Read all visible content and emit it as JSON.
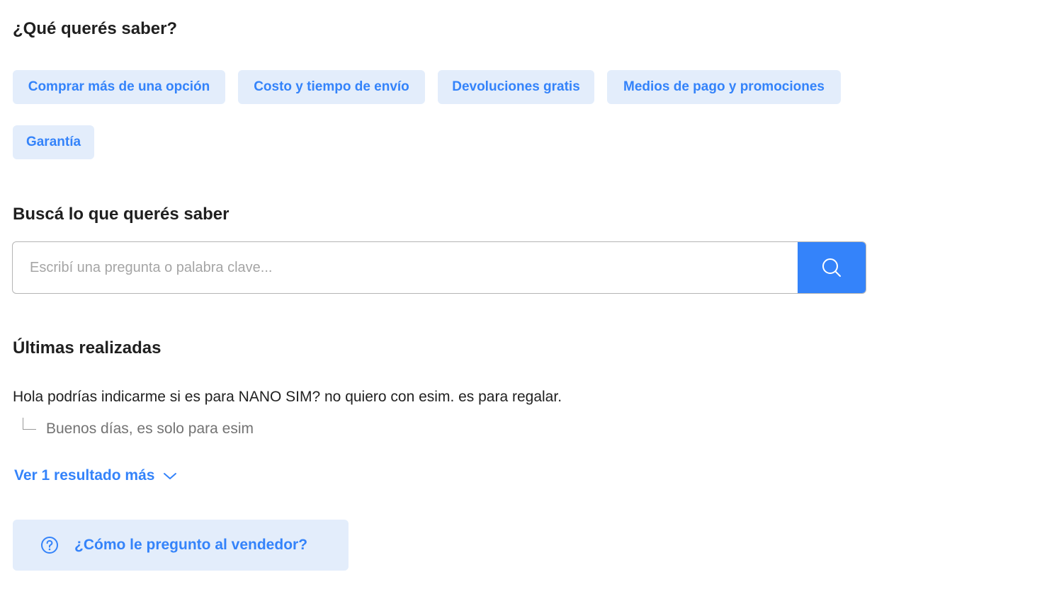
{
  "quick_questions": {
    "title": "¿Qué querés saber?",
    "chips": [
      "Comprar más de una opción",
      "Costo y tiempo de envío",
      "Devoluciones gratis",
      "Medios de pago y promociones",
      "Garantía"
    ]
  },
  "search": {
    "title": "Buscá lo que querés saber",
    "placeholder": "Escribí una pregunta o palabra clave...",
    "value": "",
    "button_icon": "search-icon"
  },
  "recent": {
    "title": "Últimas realizadas",
    "items": [
      {
        "question": "Hola podrías indicarme si es para NANO SIM? no quiero con esim. es para regalar.",
        "answer": "Buenos días, es solo para esim"
      }
    ],
    "more_label": "Ver 1 resultado más",
    "more_icon": "chevron-down-icon"
  },
  "help": {
    "label": "¿Cómo le pregunto al vendedor?",
    "icon": "question-circle-icon"
  },
  "colors": {
    "accent": "#3483fa",
    "chip_background": "#e3edfb",
    "text": "#1f1f1f",
    "muted_text": "#737373"
  }
}
